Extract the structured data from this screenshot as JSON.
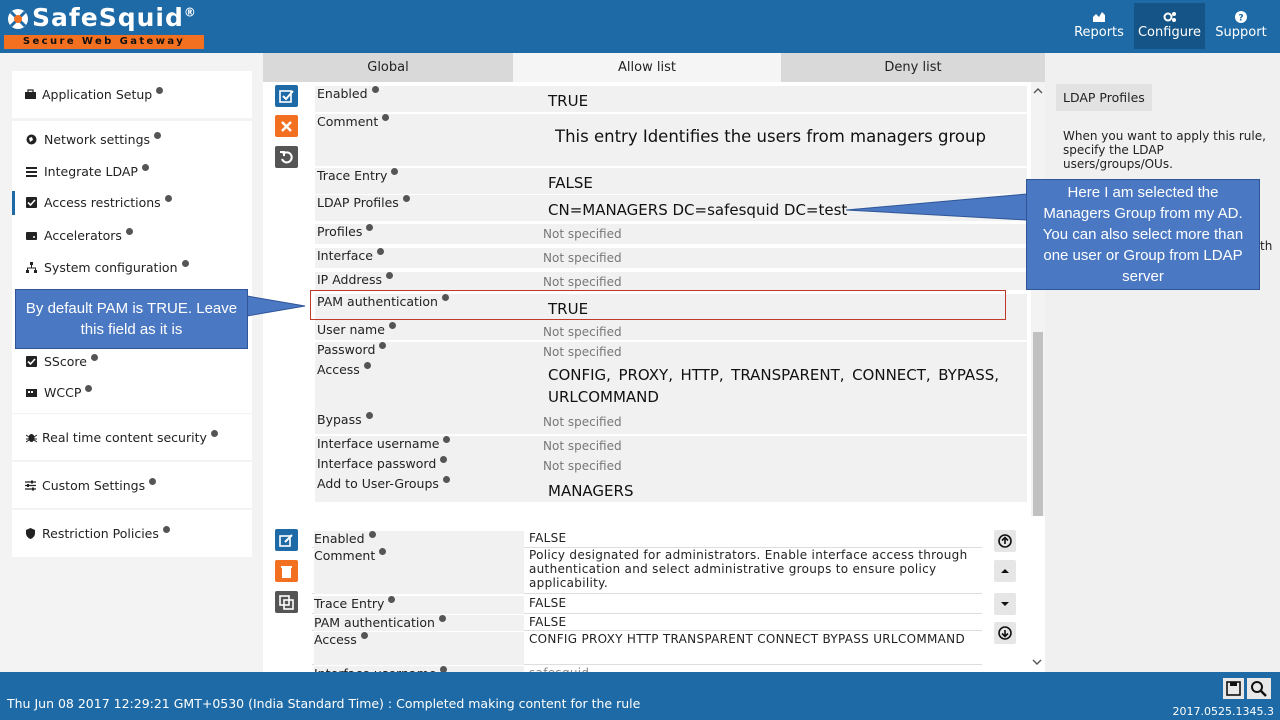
{
  "app": {
    "brand": "SafeSquid",
    "brand_mark": "®",
    "tagline": "Secure Web Gateway"
  },
  "topnav": [
    {
      "label": "Reports",
      "icon": "chart-icon"
    },
    {
      "label": "Configure",
      "icon": "cogs-icon",
      "active": true
    },
    {
      "label": "Support",
      "icon": "question-icon"
    }
  ],
  "sidebar": {
    "items": [
      {
        "label": "Application Setup",
        "icon": "briefcase-icon"
      },
      {
        "label": "Network settings",
        "icon": "globe-icon"
      },
      {
        "label": "Integrate LDAP",
        "icon": "list-icon"
      },
      {
        "label": "Access restrictions",
        "icon": "checkbox-icon",
        "active": true
      },
      {
        "label": "Accelerators",
        "icon": "hdd-icon"
      },
      {
        "label": "System configuration",
        "icon": "sitemap-icon"
      },
      {
        "label": "SScore",
        "icon": "checkbox-icon"
      },
      {
        "label": "WCCP",
        "icon": "router-icon"
      },
      {
        "label": "Real time content security",
        "icon": "bug-icon"
      },
      {
        "label": "Custom Settings",
        "icon": "sliders-icon"
      },
      {
        "label": "Restriction Policies",
        "icon": "shield-icon"
      }
    ]
  },
  "tabs": [
    "Global",
    "Allow list",
    "Deny list"
  ],
  "active_tab": "Allow list",
  "edit_entry": {
    "fields": [
      {
        "label": "Enabled",
        "value": "TRUE",
        "style": "big"
      },
      {
        "label": "Comment",
        "value": "This entry Identifies  the users from managers group",
        "style": "big"
      },
      {
        "label": "Trace Entry",
        "value": "FALSE",
        "style": "big"
      },
      {
        "label": "LDAP Profiles",
        "value": "CN=MANAGERS DC=safesquid DC=test",
        "style": "big"
      },
      {
        "label": "Profiles",
        "value": "Not specified",
        "style": "small"
      },
      {
        "label": "Interface",
        "value": "Not specified",
        "style": "small"
      },
      {
        "label": "IP Address",
        "value": "Not specified",
        "style": "small"
      },
      {
        "label": "PAM authentication",
        "value": "TRUE",
        "style": "big"
      },
      {
        "label": "User name",
        "value": "Not specified",
        "style": "small"
      },
      {
        "label": "Password",
        "value": "Not specified",
        "style": "small"
      },
      {
        "label": "Access",
        "value": "CONFIG,  PROXY,  HTTP,  TRANSPARENT,  CONNECT,  BYPASS,  URLCOMMAND",
        "style": "big"
      },
      {
        "label": "Bypass",
        "value": "Not specified",
        "style": "small"
      },
      {
        "label": "Interface username",
        "value": "Not specified",
        "style": "small"
      },
      {
        "label": "Interface password",
        "value": "Not specified",
        "style": "small"
      },
      {
        "label": "Add to User-Groups",
        "value": "MANAGERS",
        "style": "big"
      }
    ]
  },
  "entry2": {
    "fields": [
      {
        "label": "Enabled",
        "value": "FALSE"
      },
      {
        "label": "Comment",
        "value": "Policy designated for administrators. Enable interface access through authentication and select administrative groups to ensure policy applicability."
      },
      {
        "label": "Trace Entry",
        "value": "FALSE"
      },
      {
        "label": "PAM authentication",
        "value": "FALSE"
      },
      {
        "label": "Access",
        "value": "CONFIG  PROXY  HTTP  TRANSPARENT  CONNECT  BYPASS  URLCOMMAND"
      },
      {
        "label": "Interface username",
        "value": "safesquid"
      }
    ]
  },
  "right_panel": {
    "title": "LDAP Profiles",
    "text": "When you want to apply this rule, specify the LDAP users/groups/OUs.",
    "trail": "th"
  },
  "status": {
    "message": "Thu Jun 08 2017 12:29:21 GMT+0530 (India Standard Time) : Completed making content for the rule",
    "version": "2017.0525.1345.3"
  },
  "callouts": {
    "pam": "By default PAM is TRUE. Leave this field as it is",
    "ldap": "Here I am selected the Managers Group from my AD. You can also select more than one user or Group from LDAP server"
  },
  "colors": {
    "header": "#1d6aa6",
    "accent": "#f37021",
    "callout": "#4a78c2"
  }
}
